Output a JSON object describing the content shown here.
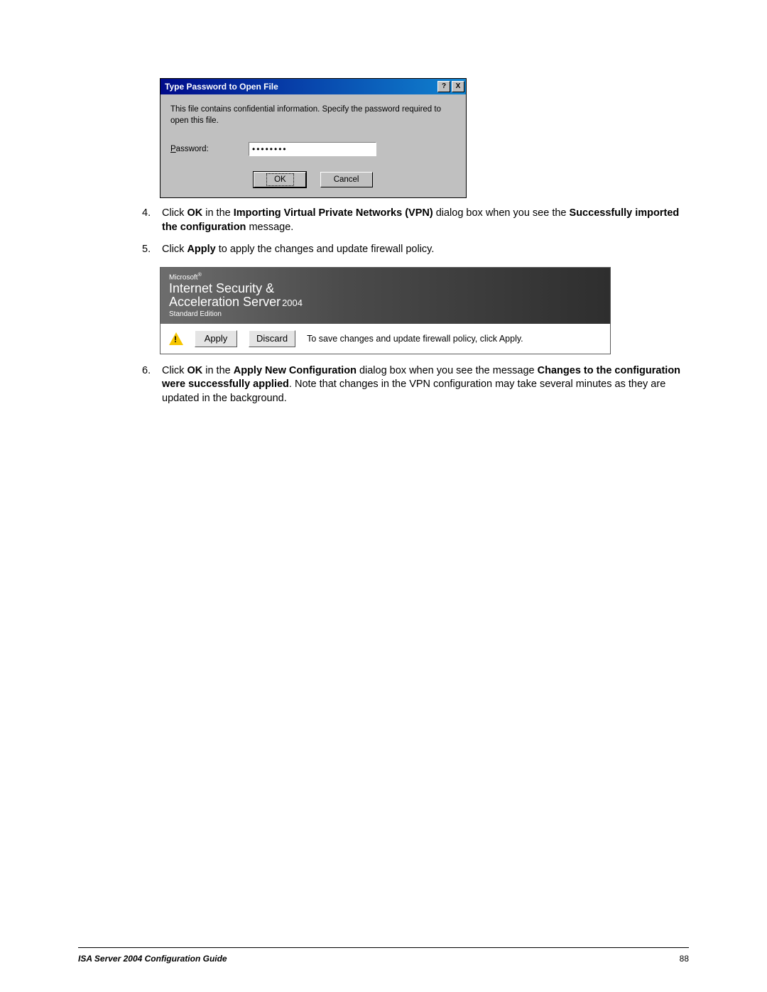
{
  "dialog": {
    "title": "Type Password to Open File",
    "help_btn": "?",
    "close_btn": "X",
    "instruction": "This file contains confidential information. Specify the password required to open this file.",
    "password_label_prefix": "P",
    "password_label_rest": "assword:",
    "password_value": "••••••••",
    "ok_label": "OK",
    "cancel_label": "Cancel"
  },
  "steps": {
    "s4": {
      "num": "4.",
      "lead": "Click ",
      "b1": "OK",
      "mid1": " in the ",
      "b2": "Importing Virtual Private Networks (VPN)",
      "mid2": " dialog box when you see the ",
      "b3": "Successfully imported the configuration",
      "tail": " message."
    },
    "s5": {
      "num": "5.",
      "lead": "Click ",
      "b1": "Apply",
      "tail": " to apply the changes and update firewall policy."
    },
    "s6": {
      "num": "6.",
      "lead": "Click ",
      "b1": "OK",
      "mid1": " in the ",
      "b2": "Apply New Configuration",
      "mid2": " dialog box when you see the message ",
      "b3": "Changes to the configuration were successfully applied",
      "tail": ". Note that changes in the VPN configuration may take several minutes as they are updated in the background."
    }
  },
  "isa": {
    "ms": "Microsoft",
    "name_line1": "Internet Security &",
    "name_line2": "Acceleration Server",
    "year": "2004",
    "edition": "Standard Edition",
    "apply_label": "Apply",
    "discard_label": "Discard",
    "message": "To save changes and update firewall policy, click Apply."
  },
  "footer": {
    "title": "ISA Server 2004 Configuration Guide",
    "page": "88"
  }
}
